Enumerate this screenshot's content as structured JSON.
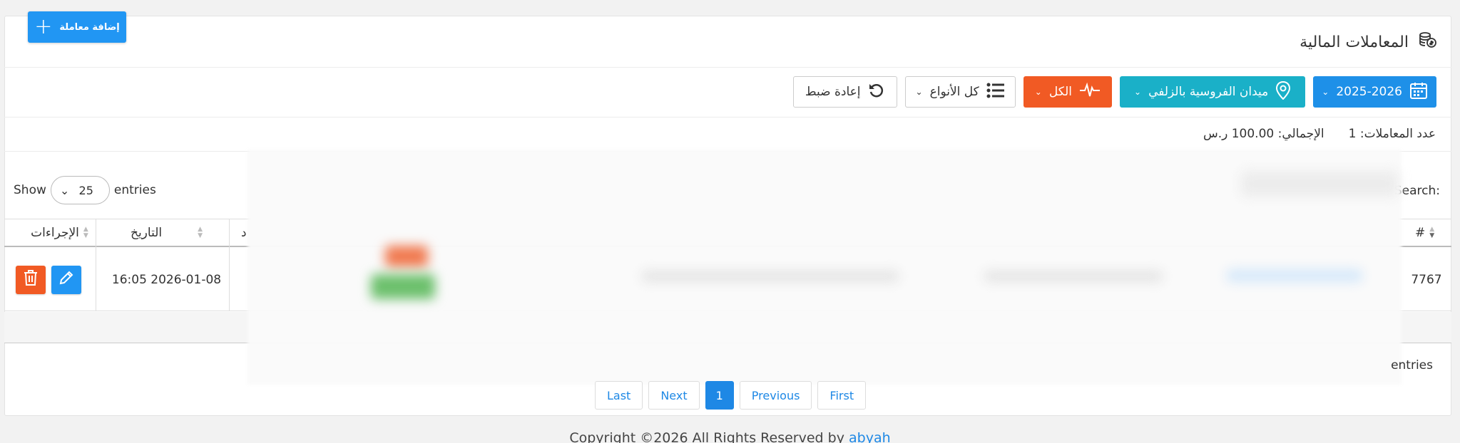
{
  "header": {
    "title": "المعاملات المالية",
    "add_button_label": "إضافة معاملة"
  },
  "filters": {
    "year": "2025-2026",
    "location": "ميدان الفروسية بالزلفي",
    "status": "الكل",
    "types": "كل الأنواع",
    "reset": "إعادة ضبط"
  },
  "summary": {
    "count_label": "عدد المعاملات: 1",
    "total_label": "الإجمالي: 100.00 ر.س"
  },
  "table_controls": {
    "show_label": "Show",
    "page_size": "25",
    "entries_label": "entries",
    "search_label": "Search:",
    "entries_bottom": "entries"
  },
  "table": {
    "col_id": "#",
    "col_date": "التاريخ",
    "col_actions": "الإجراءات",
    "col_partial": "د",
    "row": {
      "id": "7767",
      "date": "16:05 2026-01-08"
    }
  },
  "pagination": {
    "first": "First",
    "previous": "Previous",
    "current": "1",
    "next": "Next",
    "last": "Last"
  },
  "footer": {
    "copyright_text": "Copyright ©2026 All Rights Reserved by ",
    "brand": "abyah"
  },
  "colors": {
    "primary": "#2196f3",
    "teal": "#1ab0c8",
    "orange": "#f15a24",
    "danger": "#f15a24"
  }
}
